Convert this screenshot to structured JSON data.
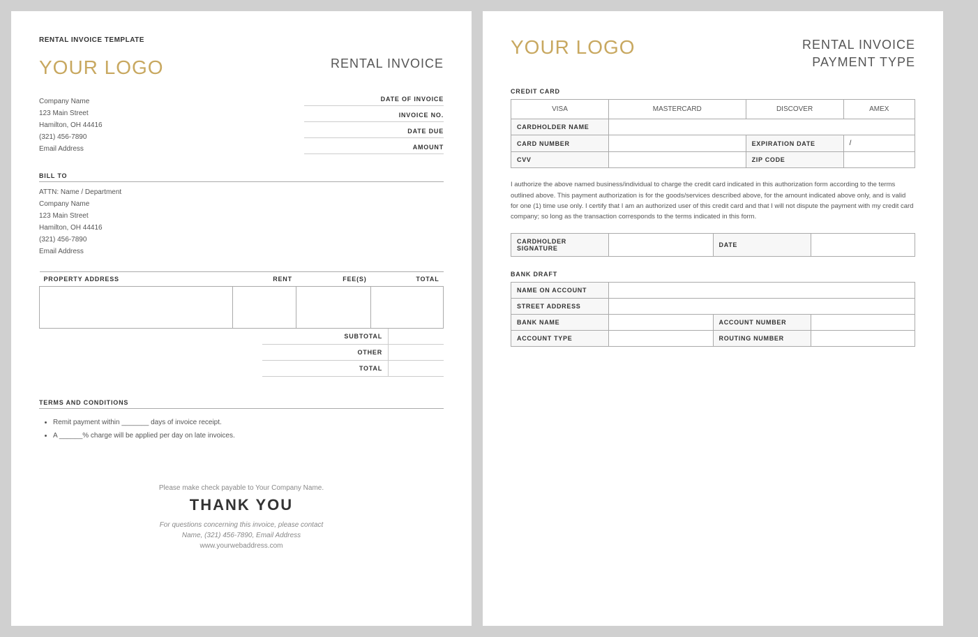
{
  "left_page": {
    "page_title": "RENTAL INVOICE TEMPLATE",
    "logo": "YOUR LOGO",
    "invoice_title": "RENTAL INVOICE",
    "company": {
      "name": "Company Name",
      "street": "123 Main Street",
      "city_state": "Hamilton, OH  44416",
      "phone": "(321) 456-7890",
      "email": "Email Address"
    },
    "date_fields": [
      "DATE OF INVOICE",
      "INVOICE NO.",
      "DATE DUE",
      "AMOUNT"
    ],
    "bill_to_label": "BILL TO",
    "bill_to": {
      "attn": "ATTN: Name / Department",
      "company": "Company Name",
      "street": "123 Main Street",
      "city_state": "Hamilton, OH  44416",
      "phone": "(321) 456-7890",
      "email": "Email Address"
    },
    "table_headers": [
      "PROPERTY ADDRESS",
      "RENT",
      "FEE(S)",
      "TOTAL"
    ],
    "totals": [
      {
        "label": "SUBTOTAL",
        "value": ""
      },
      {
        "label": "OTHER",
        "value": ""
      },
      {
        "label": "TOTAL",
        "value": ""
      }
    ],
    "terms_label": "TERMS AND CONDITIONS",
    "terms_items": [
      "Remit payment within _______ days of invoice receipt.",
      "A ______% charge will be applied per day on late invoices."
    ],
    "footer": {
      "check_payable": "Please make check payable to Your Company Name.",
      "thank_you": "THANK YOU",
      "questions": "For questions concerning this invoice, please contact",
      "contact_info": "Name, (321) 456-7890, Email Address",
      "website": "www.yourwebaddress.com"
    }
  },
  "right_page": {
    "logo": "YOUR LOGO",
    "title_line1": "RENTAL INVOICE",
    "title_line2": "PAYMENT TYPE",
    "credit_card": {
      "section_label": "CREDIT CARD",
      "options": [
        "VISA",
        "MASTERCARD",
        "DISCOVER",
        "AMEX"
      ],
      "fields": [
        {
          "label": "CARDHOLDER NAME",
          "value": "",
          "colspan": 3
        },
        {
          "label": "CARD NUMBER",
          "value": "",
          "right_label": "EXPIRATION DATE",
          "right_value": "/"
        },
        {
          "label": "CVV",
          "value": "",
          "right_label": "ZIP CODE",
          "right_value": ""
        }
      ]
    },
    "authorization_text": "I authorize the above named business/individual to charge the credit card indicated in this authorization form according to the terms outlined above. This payment authorization is for the goods/services described above, for the amount indicated above only, and is valid for one (1) time use only. I certify that I am an authorized user of this credit card and that I will not dispute the payment with my credit card company; so long as the transaction corresponds to the terms indicated in this form.",
    "signature_row": {
      "left_label": "CARDHOLDER\nSIGNATURE",
      "left_value": "",
      "right_label": "DATE",
      "right_value": ""
    },
    "bank_draft": {
      "section_label": "BANK DRAFT",
      "fields": [
        {
          "label": "NAME ON ACCOUNT",
          "value": "",
          "full_width": true
        },
        {
          "label": "STREET ADDRESS",
          "value": "",
          "full_width": true
        },
        {
          "label": "BANK NAME",
          "value": "",
          "right_label": "ACCOUNT NUMBER",
          "right_value": ""
        },
        {
          "label": "ACCOUNT TYPE",
          "value": "",
          "right_label": "ROUTING NUMBER",
          "right_value": ""
        }
      ]
    }
  }
}
